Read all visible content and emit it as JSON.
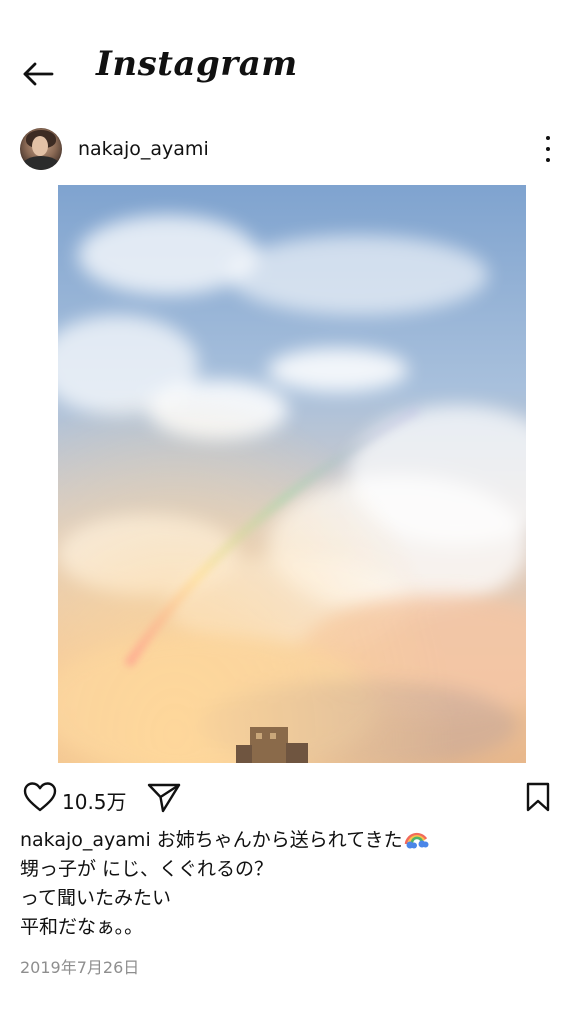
{
  "header": {
    "logo_text": "Instagram",
    "back_icon": "arrow-left-icon"
  },
  "post": {
    "username": "nakajo_ayami",
    "avatar_icon": "avatar-photo",
    "more_icon": "more-vertical-icon",
    "likes": "10.5万",
    "caption": {
      "user": "nakajo_ayami",
      "line1": "お姉ちゃんから送られてきた",
      "line1_emoji": "rainbow-emoji",
      "line2": "甥っ子が にじ、くぐれるの？",
      "line3": "って聞いたみたい",
      "line4": "平和だなぁ。。"
    },
    "date": "2019年7月26日"
  },
  "colors": {
    "text": "#111111",
    "muted": "#8e8e8e",
    "background": "#ffffff"
  }
}
